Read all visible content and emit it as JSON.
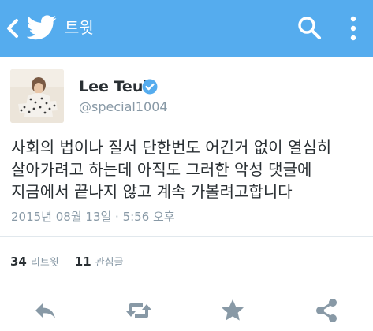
{
  "appbar": {
    "title": "트윗",
    "icons": [
      "back-arrow-icon",
      "twitter-bird-icon",
      "search-icon",
      "more-vert-icon"
    ]
  },
  "tweet": {
    "author_name": "Lee Teuk",
    "handle": "@special1004",
    "verified": true,
    "text_lines": [
      "사회의 법이나 질서 단한번도 어긴거 없이 열심히",
      "살아가려고 하는데 아직도 그러한 악성 댓글에",
      "지금에서 끝나지 않고 계속 가볼려고합니다"
    ],
    "timestamp": "2015년 08월 13일 · 5:56 오후"
  },
  "stats": {
    "retweets_count": "34",
    "retweets_label": "리트윗",
    "favorites_count": "11",
    "favorites_label": "관심글"
  },
  "actions": [
    "reply-icon",
    "retweet-icon",
    "favorite-star-icon",
    "share-icon"
  ],
  "colors": {
    "appbar": "#55acee",
    "text": "#292f33",
    "secondary": "#8899a6",
    "icon_gray": "#8899a6",
    "divider": "#e1e8ed"
  }
}
